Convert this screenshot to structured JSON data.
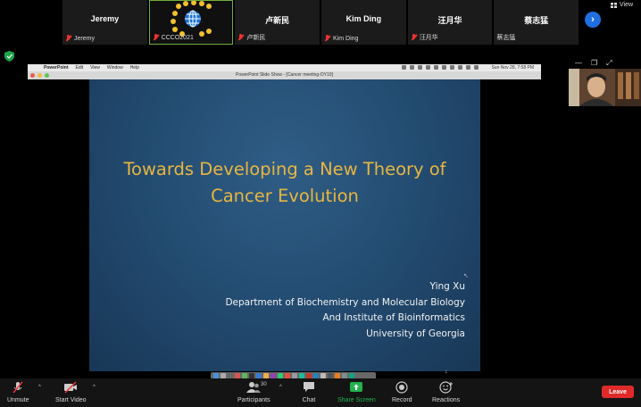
{
  "participants": [
    {
      "name": "Jeremy",
      "label": "Jeremy"
    },
    {
      "name": "",
      "label": "CCCO2021"
    },
    {
      "name": "卢新民",
      "label": "卢新民"
    },
    {
      "name": "Kim Ding",
      "label": "Kim Ding"
    },
    {
      "name": "汪月华",
      "label": "汪月华"
    },
    {
      "name": "蔡志猛",
      "label": "蔡志猛"
    }
  ],
  "view_label": "View",
  "mac_menu": [
    "PowerPoint",
    "Edit",
    "View",
    "Window",
    "Help"
  ],
  "mac_clock": "Sun Nov 28, 7:58 PM",
  "window_title": "PowerPoint Slide Show - [Cancer meeting-OY10]",
  "slide": {
    "title_line1": "Towards Developing a New Theory of",
    "title_line2": "Cancer Evolution",
    "author": "Ying Xu",
    "affiliation1": "Department of Biochemistry and Molecular Biology",
    "affiliation2": "And Institute of Bioinformatics",
    "affiliation3": "University of Georgia"
  },
  "toolbar": {
    "unmute": "Unmute",
    "start_video": "Start Video",
    "participants": "Participants",
    "participant_count": "30",
    "chat": "Chat",
    "share_screen": "Share Screen",
    "record": "Record",
    "reactions": "Reactions",
    "leave": "Leave"
  },
  "colors": {
    "slide_title": "#e8b640",
    "share_green": "#22b14c",
    "leave_red": "#e02a2a",
    "active_border": "#6fae3a",
    "next_blue": "#1f6fe0"
  }
}
